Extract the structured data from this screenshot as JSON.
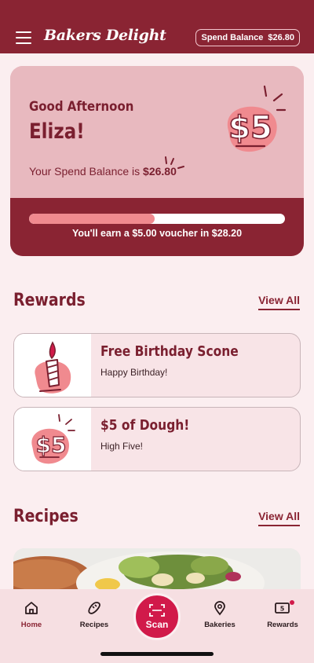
{
  "header": {
    "logo_text": "Bakers Delight",
    "balance_label": "Spend Balance",
    "balance_value": "$26.80"
  },
  "greeting": {
    "hello": "Good Afternoon",
    "name": "Eliza!",
    "balance_prefix": "Your Spend Balance is",
    "balance_value": "$26.80",
    "badge_text": "$5",
    "progress_fraction": 0.49,
    "progress_text": "You'll earn a $5.00 voucher in",
    "progress_amount": "$28.20"
  },
  "rewards": {
    "title": "Rewards",
    "view_all": "View All",
    "items": [
      {
        "title": "Free Birthday Scone",
        "subtitle": "Happy Birthday!",
        "icon": "birthday-candle-icon"
      },
      {
        "title": "$5 of Dough!",
        "subtitle": "High Five!",
        "icon": "five-dollar-icon",
        "badge_text": "$5"
      }
    ]
  },
  "recipes": {
    "title": "Recipes",
    "view_all": "View All"
  },
  "tabbar": {
    "items": [
      {
        "label": "Home",
        "icon": "home-icon",
        "active": true
      },
      {
        "label": "Recipes",
        "icon": "bread-icon"
      },
      {
        "label": "Bakeries",
        "icon": "map-pin-icon"
      },
      {
        "label": "Rewards",
        "icon": "voucher-icon"
      }
    ],
    "scan_label": "Scan"
  },
  "colors": {
    "brand": "#8a2433",
    "accent": "#d11a4a",
    "card_pink": "#e8b9bf",
    "progress": "#f08a8f"
  }
}
